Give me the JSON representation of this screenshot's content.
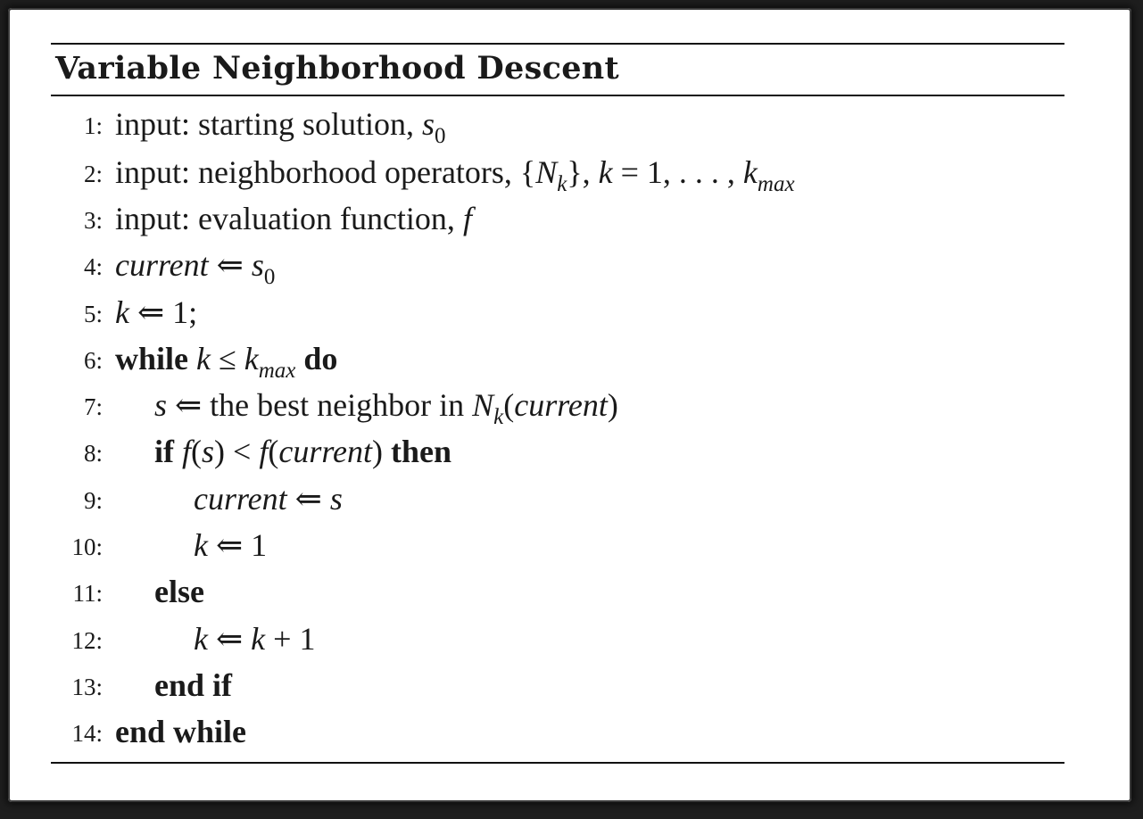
{
  "title": "Variable Neighborhood Descent",
  "lines": [
    {
      "num": "1:",
      "input_kw": "input:",
      "text": " starting solution, ",
      "var": "s",
      "sub": "0"
    },
    {
      "num": "2:",
      "input_kw": "input:",
      "text": " neighborhood operators, {",
      "var_n": "N",
      "sub_k": "k",
      "mid": "}, ",
      "var_k": "k",
      "eq": " = 1, . . . , ",
      "var_k2": "k",
      "sub_max": "max"
    },
    {
      "num": "3:",
      "input_kw": "input:",
      "text": " evaluation function, ",
      "var_f": "f"
    },
    {
      "num": "4:",
      "var_current": "current",
      "arrow": " ⇐ ",
      "var_s": "s",
      "sub": "0"
    },
    {
      "num": "5:",
      "var_k": "k",
      "rest": " ⇐ 1;"
    },
    {
      "num": "6:",
      "kw_while": "while",
      "var_k": "k",
      "leq": " ≤ ",
      "var_k2": "k",
      "sub_max": "max",
      "kw_do": "do"
    },
    {
      "num": "7:",
      "var_s": "s",
      "text": " ⇐ the best neighbor in ",
      "var_n": "N",
      "sub_k": "k",
      "paren_open": "(",
      "var_current": "current",
      "paren_close": ")"
    },
    {
      "num": "8:",
      "kw_if": "if",
      "var_f": "f",
      "p1": "(",
      "var_s": "s",
      "p2": ") < ",
      "var_f2": "f",
      "p3": "(",
      "var_current": "current",
      "p4": ")",
      "kw_then": "then"
    },
    {
      "num": "9:",
      "var_current": "current",
      "arrow": " ⇐ ",
      "var_s": "s"
    },
    {
      "num": "10:",
      "var_k": "k",
      "rest": " ⇐ 1"
    },
    {
      "num": "11:",
      "kw_else": "else"
    },
    {
      "num": "12:",
      "var_k": "k",
      "arrow": " ⇐ ",
      "var_k2": "k",
      "rest": " + 1"
    },
    {
      "num": "13:",
      "kw_endif": "end if"
    },
    {
      "num": "14:",
      "kw_endwhile": "end while"
    }
  ]
}
